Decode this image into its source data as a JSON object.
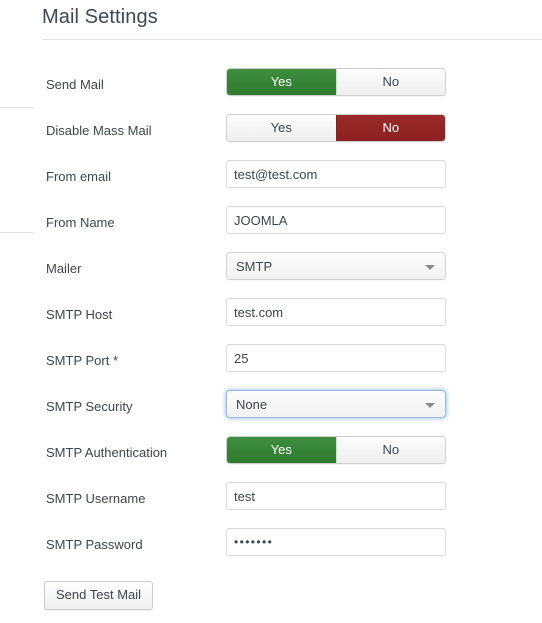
{
  "header": {
    "title": "Mail Settings"
  },
  "form": {
    "rows": [
      {
        "label": "Send Mail",
        "type": "toggle",
        "yes_label": "Yes",
        "no_label": "No",
        "selected": "Yes"
      },
      {
        "label": "Disable Mass Mail",
        "type": "toggle",
        "yes_label": "Yes",
        "no_label": "No",
        "selected": "No"
      },
      {
        "label": "From email",
        "type": "text",
        "value": "test@test.com",
        "placeholder": ""
      },
      {
        "label": "From Name",
        "type": "text",
        "value": "JOOMLA",
        "placeholder": ""
      },
      {
        "label": "Mailer",
        "type": "select",
        "value": "SMTP",
        "focused": false
      },
      {
        "label": "SMTP Host",
        "type": "text",
        "value": "test.com",
        "placeholder": ""
      },
      {
        "label": "SMTP Port *",
        "type": "text",
        "value": "25",
        "placeholder": ""
      },
      {
        "label": "SMTP Security",
        "type": "select",
        "value": "None",
        "focused": true
      },
      {
        "label": "SMTP Authentication",
        "type": "toggle",
        "yes_label": "Yes",
        "no_label": "No",
        "selected": "Yes"
      },
      {
        "label": "SMTP Username",
        "type": "text",
        "value": "test",
        "placeholder": ""
      },
      {
        "label": "SMTP Password",
        "type": "password",
        "value": "•••••••",
        "placeholder": ""
      }
    ]
  },
  "footer": {
    "send_test_mail_label": "Send Test Mail"
  },
  "colors": {
    "toggle_yes_on": "#3f8f3f",
    "toggle_no_on": "#9c2a2a",
    "focus_ring": "#9cb7e0",
    "title_text": "#3e4855",
    "label_text": "#3f454d",
    "input_border": "#dcdcdc",
    "rule": "#e5e5e5"
  },
  "icons": {
    "caret": "chevron-down-icon"
  }
}
